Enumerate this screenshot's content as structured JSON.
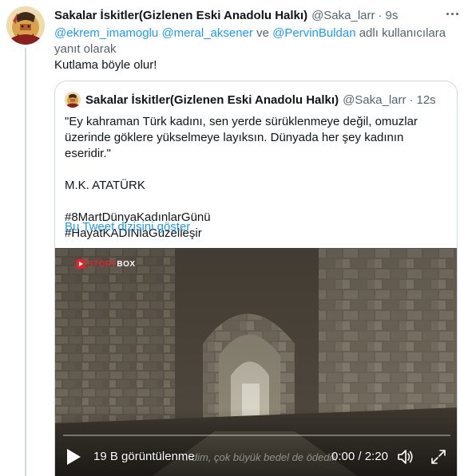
{
  "tweet": {
    "author_name": "Sakalar İskitler(Gizlenen Eski Anadolu Halkı)",
    "author_handle": "@Saka_larr",
    "separator": "·",
    "time": "9s",
    "reply_mentions": [
      "@ekrem_imamoglu",
      "@meral_aksener",
      "@PervinBuldan"
    ],
    "reply_joiner": "ve",
    "reply_suffix": "adlı kullanıcılara yanıt olarak",
    "text": "Kutlama böyle olur!",
    "more_icon": "more-horizontal-icon"
  },
  "quote": {
    "author_name": "Sakalar İskitler(Gizlenen Eski Anadolu Halkı)",
    "author_handle": "@Saka_larr",
    "separator": "·",
    "time": "12s",
    "lines": {
      "quote_line_1": "\"Ey kahraman Türk kadını, sen yerde sürüklenmeye değil, omuzlar",
      "quote_line_2": "üzerinde göklere yükselmeye layıksın. Dünyada her şey kadının eseridir.\"",
      "signature": "M.K. ATATÜRK",
      "hashtag_1": "#8MartDünyaKadınlarGünü",
      "hashtag_2": "#HayatKADINlaGüzelleşir"
    },
    "show_thread": "Bu Tweet dizisini göster"
  },
  "video": {
    "logo_text_red": "STORY",
    "logo_text_white": "BOX",
    "views": "19 B görüntülenme",
    "subtitle": "...dim, çok büyük bedel de ödedik",
    "current_time": "0:00",
    "time_separator": "/",
    "duration": "2:20",
    "progress": 0,
    "play_icon": "play-icon",
    "volume_icon": "volume-icon",
    "fullscreen_icon": "fullscreen-icon"
  },
  "colors": {
    "link": "#1d9bf0",
    "secondary_text": "#536471",
    "primary_text": "#0f1419",
    "border": "#cfd9de"
  }
}
